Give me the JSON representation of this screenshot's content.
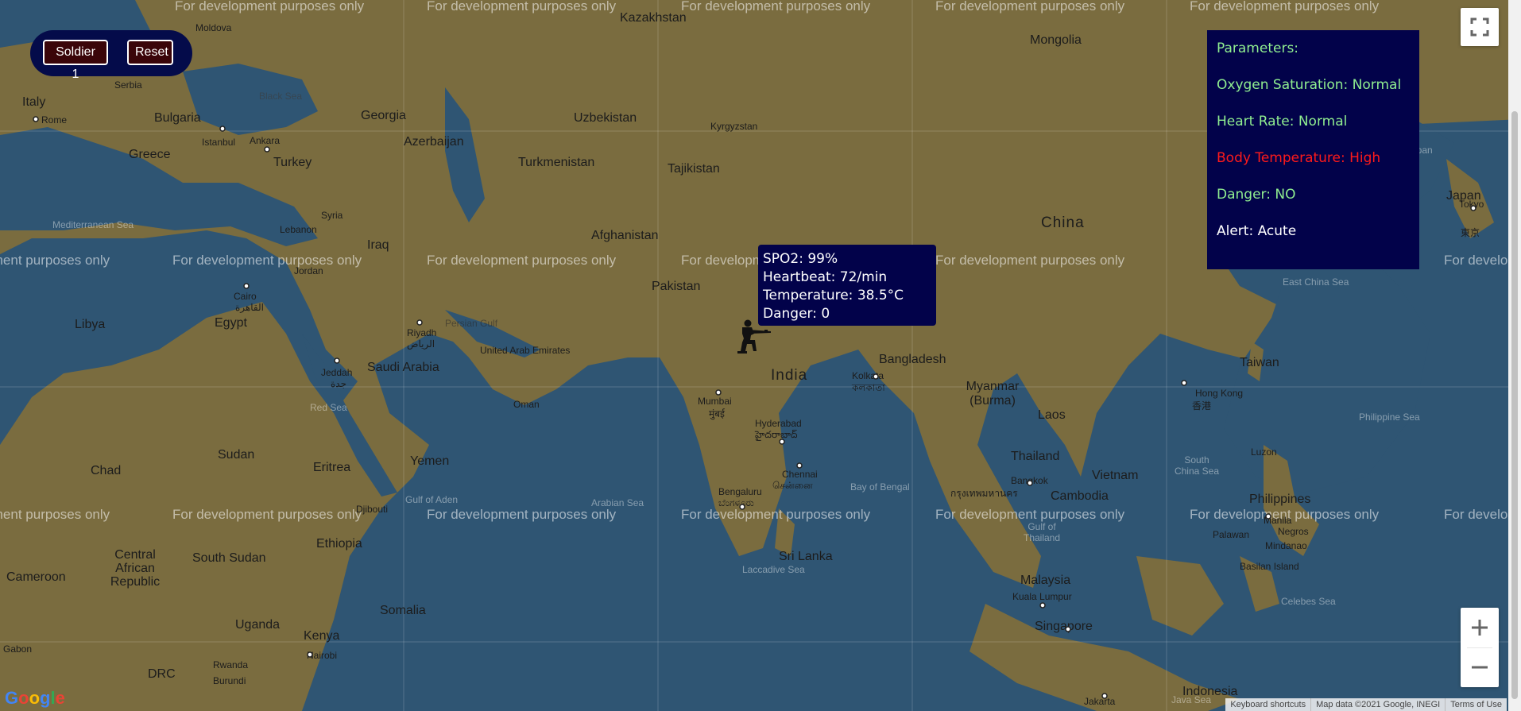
{
  "controls": {
    "soldier_label": "Soldier 1",
    "reset_label": "Reset",
    "pill_color": "#040b4a",
    "button_color": "#3a0509"
  },
  "parameters_panel": {
    "title": "Parameters:",
    "oxygen": "Oxygen Saturation: Normal",
    "heart_rate": "Heart Rate: Normal",
    "body_temp": "Body Temperature: High",
    "danger": "Danger: NO",
    "alert": "Alert: Acute",
    "normal_color": "#90ee90",
    "alert_color": "#ff1a1a",
    "panel_color": "#02024a"
  },
  "tooltip": {
    "spo2": "SPO2: 99%",
    "heartbeat": "Heartbeat: 72/min",
    "temperature": "Temperature: 38.5°C",
    "danger": "Danger: 0"
  },
  "marker": {
    "icon": "soldier-icon"
  },
  "watermark_text": "For development purposes only",
  "map_labels": {
    "countries": [
      "Kazakhstan",
      "Mongolia",
      "Moldova",
      "Serbia",
      "Italy",
      "Bulgaria",
      "Greece",
      "Turkey",
      "Georgia",
      "Azerbaijan",
      "Uzbekistan",
      "Kyrgyzstan",
      "Turkmenistan",
      "Tajikistan",
      "Syria",
      "Lebanon",
      "Iraq",
      "Afghanistan",
      "Jordan",
      "Pakistan",
      "Libya",
      "Egypt",
      "Saudi Arabia",
      "United Arab Emirates",
      "Oman",
      "Sudan",
      "Yemen",
      "Chad",
      "Eritrea",
      "Djibouti",
      "Ethiopia",
      "South Sudan",
      "Central African Republic",
      "Cameroon",
      "Uganda",
      "Kenya",
      "Somalia",
      "Rwanda",
      "Burundi",
      "DRC",
      "Gabon",
      "Bangladesh",
      "Myanmar (Burma)",
      "Laos",
      "Thailand",
      "Vietnam",
      "Cambodia",
      "Malaysia",
      "Singapore",
      "Indonesia",
      "Philippines",
      "Taiwan",
      "Japan",
      "Sri Lanka"
    ],
    "big": [
      "China",
      "India"
    ],
    "cities": [
      "Rome",
      "Istanbul",
      "Ankara",
      "Cairo",
      "القاهرة",
      "Riyadh",
      "الرياض",
      "Jeddah",
      "جدة",
      "Mumbai",
      "मुंबई",
      "Hyderabad",
      "హైదరాబాద్",
      "Chennai",
      "சென்னை",
      "Bengaluru",
      "ಬೆಂಗಳೂರು",
      "Kolkata",
      "কলকাতা",
      "Bangkok",
      "กรุงเทพมหานคร",
      "Kuala Lumpur",
      "Hong Kong",
      "香港",
      "Manila",
      "Negros",
      "Mindanao",
      "Palawan",
      "Basilan Island",
      "Luzon",
      "Jakarta",
      "Nairobi",
      "Tokyo",
      "東京"
    ],
    "seas": [
      "Black Sea",
      "Mediterranean Sea",
      "Persian Gulf",
      "Red Sea",
      "Gulf of Aden",
      "Arabian Sea",
      "Bay of Bengal",
      "Laccadive Sea",
      "East China Sea",
      "South China Sea",
      "Philippine Sea",
      "Celebes Sea",
      "Java Sea",
      "Gulf of Thailand",
      "Japan"
    ]
  },
  "footer": {
    "shortcuts": "Keyboard shortcuts",
    "map_data": "Map data ©2021 Google, INEGI",
    "terms": "Terms of Use"
  },
  "logo": {
    "text": "Google"
  },
  "icons": [
    "fullscreen-icon",
    "zoom-in-icon",
    "zoom-out-icon",
    "soldier-icon"
  ]
}
